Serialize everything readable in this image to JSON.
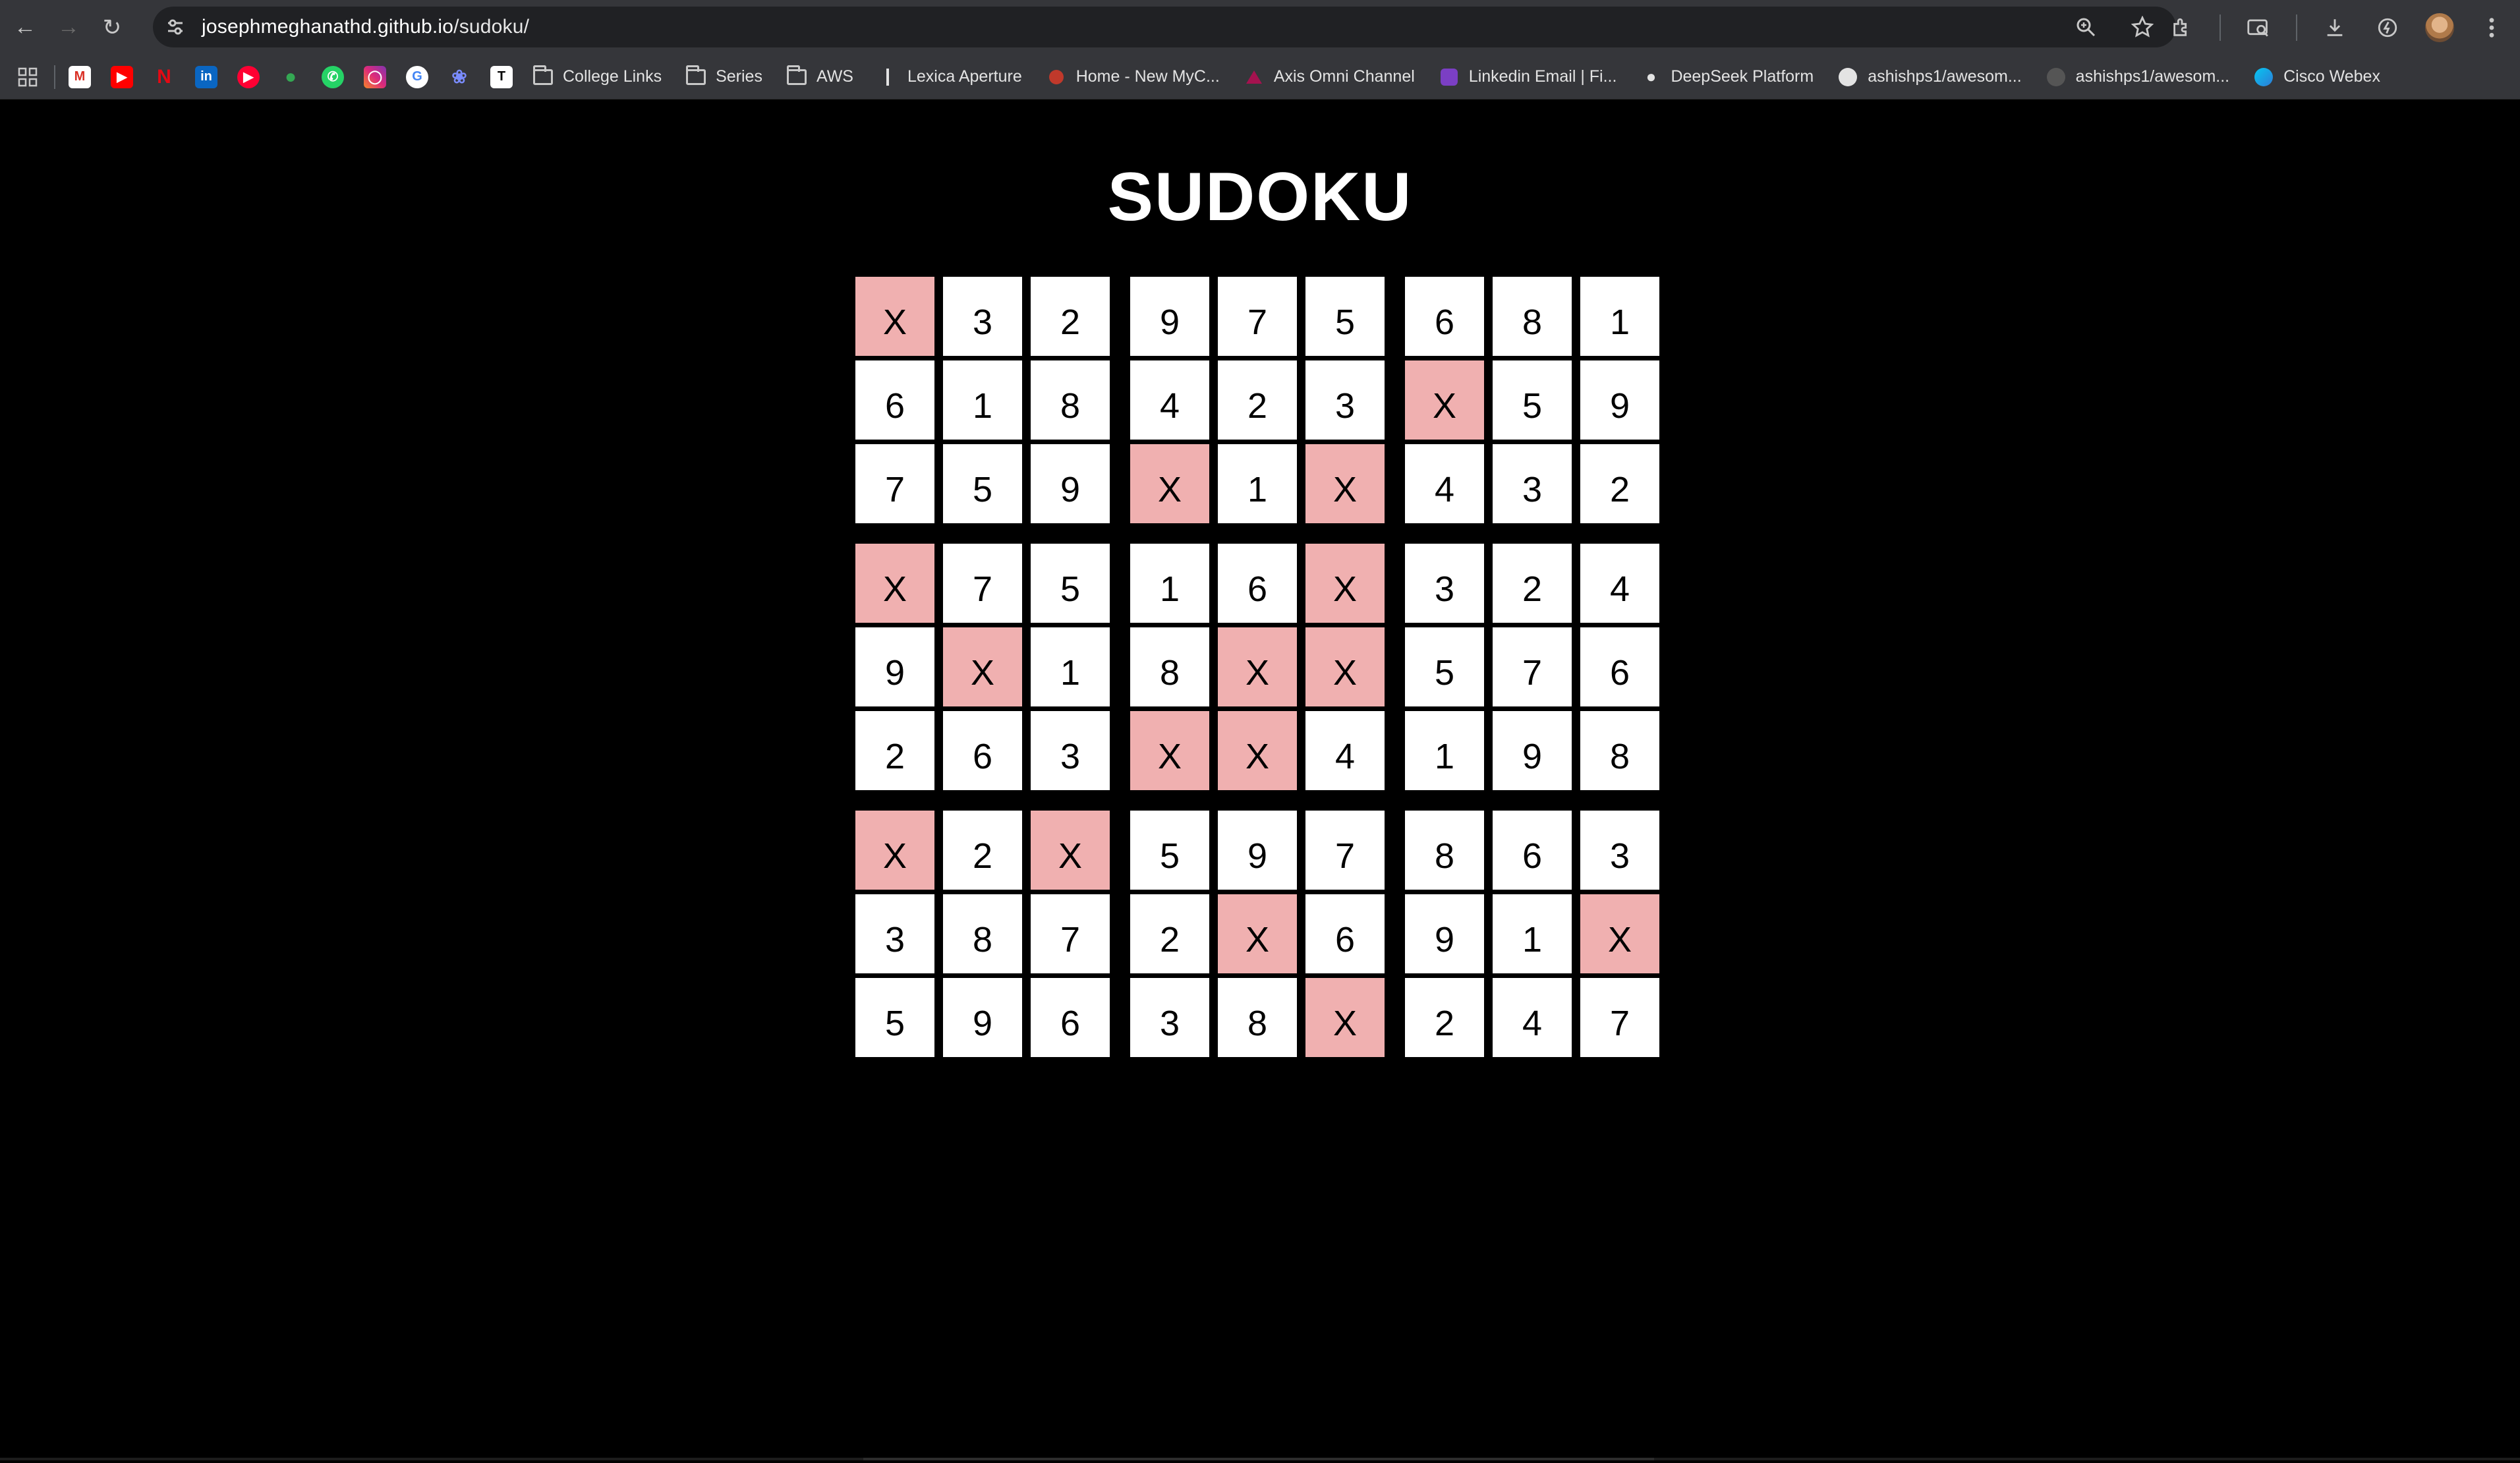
{
  "browser": {
    "url_host": "josephmeghanathd.github.io",
    "url_path": "/sudoku/",
    "bookmarks_app_icons": [
      "gmail-icon",
      "youtube-icon",
      "netflix-icon",
      "linkedin-icon",
      "youtube-music-icon",
      "google-maps-icon",
      "whatsapp-icon",
      "instagram-icon",
      "google-icon",
      "chatgpt-icon",
      "notion-icon"
    ],
    "bookmarks": [
      {
        "label": "College Links",
        "icon": "folder-icon"
      },
      {
        "label": "Series",
        "icon": "folder-icon"
      },
      {
        "label": "AWS",
        "icon": "folder-icon"
      },
      {
        "label": "Lexica Aperture",
        "icon": "lexica-icon"
      },
      {
        "label": "Home - New MyC...",
        "icon": "myc-icon"
      },
      {
        "label": "Axis Omni Channel",
        "icon": "axis-icon"
      },
      {
        "label": "Linkedin Email | Fi...",
        "icon": "linkedin-email-icon"
      },
      {
        "label": "DeepSeek Platform",
        "icon": "deepseek-icon"
      },
      {
        "label": "ashishps1/awesom...",
        "icon": "github-icon"
      },
      {
        "label": "ashishps1/awesom...",
        "icon": "github-icon"
      },
      {
        "label": "Cisco Webex",
        "icon": "webex-icon"
      }
    ]
  },
  "page": {
    "title": "SUDOKU"
  },
  "colors": {
    "page_background": "#000000",
    "cell_background": "#ffffff",
    "invalid_cell_background": "#f0b0b0",
    "cell_text": "#000000"
  },
  "board": {
    "rows": [
      [
        "X",
        "3",
        "2",
        "9",
        "7",
        "5",
        "6",
        "8",
        "1"
      ],
      [
        "6",
        "1",
        "8",
        "4",
        "2",
        "3",
        "X",
        "5",
        "9"
      ],
      [
        "7",
        "5",
        "9",
        "X",
        "1",
        "X",
        "4",
        "3",
        "2"
      ],
      [
        "X",
        "7",
        "5",
        "1",
        "6",
        "X",
        "3",
        "2",
        "4"
      ],
      [
        "9",
        "X",
        "1",
        "8",
        "X",
        "X",
        "5",
        "7",
        "6"
      ],
      [
        "2",
        "6",
        "3",
        "X",
        "X",
        "4",
        "1",
        "9",
        "8"
      ],
      [
        "X",
        "2",
        "X",
        "5",
        "9",
        "7",
        "8",
        "6",
        "3"
      ],
      [
        "3",
        "8",
        "7",
        "2",
        "X",
        "6",
        "9",
        "1",
        "X"
      ],
      [
        "5",
        "9",
        "6",
        "3",
        "8",
        "X",
        "2",
        "4",
        "7"
      ]
    ]
  }
}
